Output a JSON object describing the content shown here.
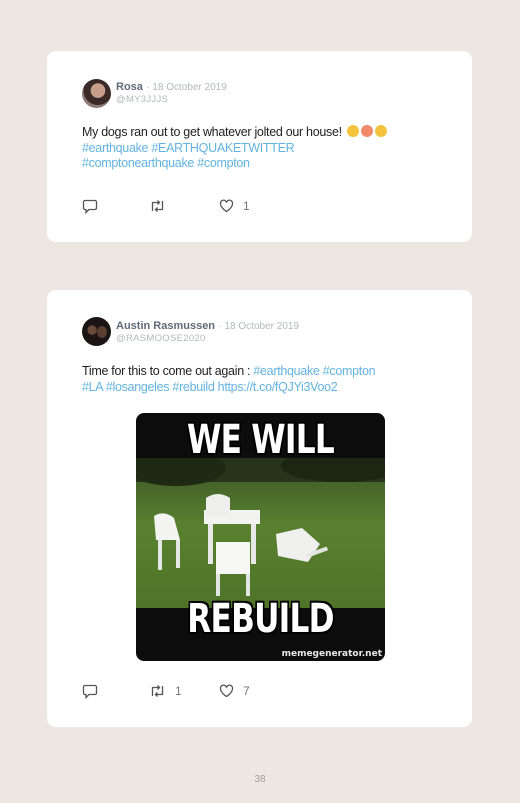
{
  "posts": [
    {
      "name": "Rosa",
      "separator": "·",
      "date": "18 October 2019",
      "handle": "@MY3JJJS",
      "text_plain": "My dogs ran out to get whatever jolted our house!",
      "hashtags_line1": "#earthquake #EARTHQUAKETWITTER",
      "hashtags_line2": "#comptonearthquake #compton",
      "reply_count": "",
      "retweet_count": "",
      "like_count": "1"
    },
    {
      "name": "Austin Rasmussen",
      "separator": "·",
      "date": "18 October 2019",
      "handle": "@RASMOOSE2020",
      "text_plain": "Time for this to come out again : ",
      "hashtags_inline": "#earthquake #compton",
      "hashtags_line2": "#LA #losangeles #rebuild https://t.co/fQJYi3Voo2",
      "image": {
        "top_text": "WE WILL",
        "bottom_text": "REBUILD",
        "watermark": "memegenerator.net"
      },
      "reply_count": "",
      "retweet_count": "1",
      "like_count": "7"
    }
  ],
  "page_number": "38",
  "colors": {
    "link": "#63b3e0",
    "background": "#ece8e1",
    "card": "#ffffff"
  }
}
